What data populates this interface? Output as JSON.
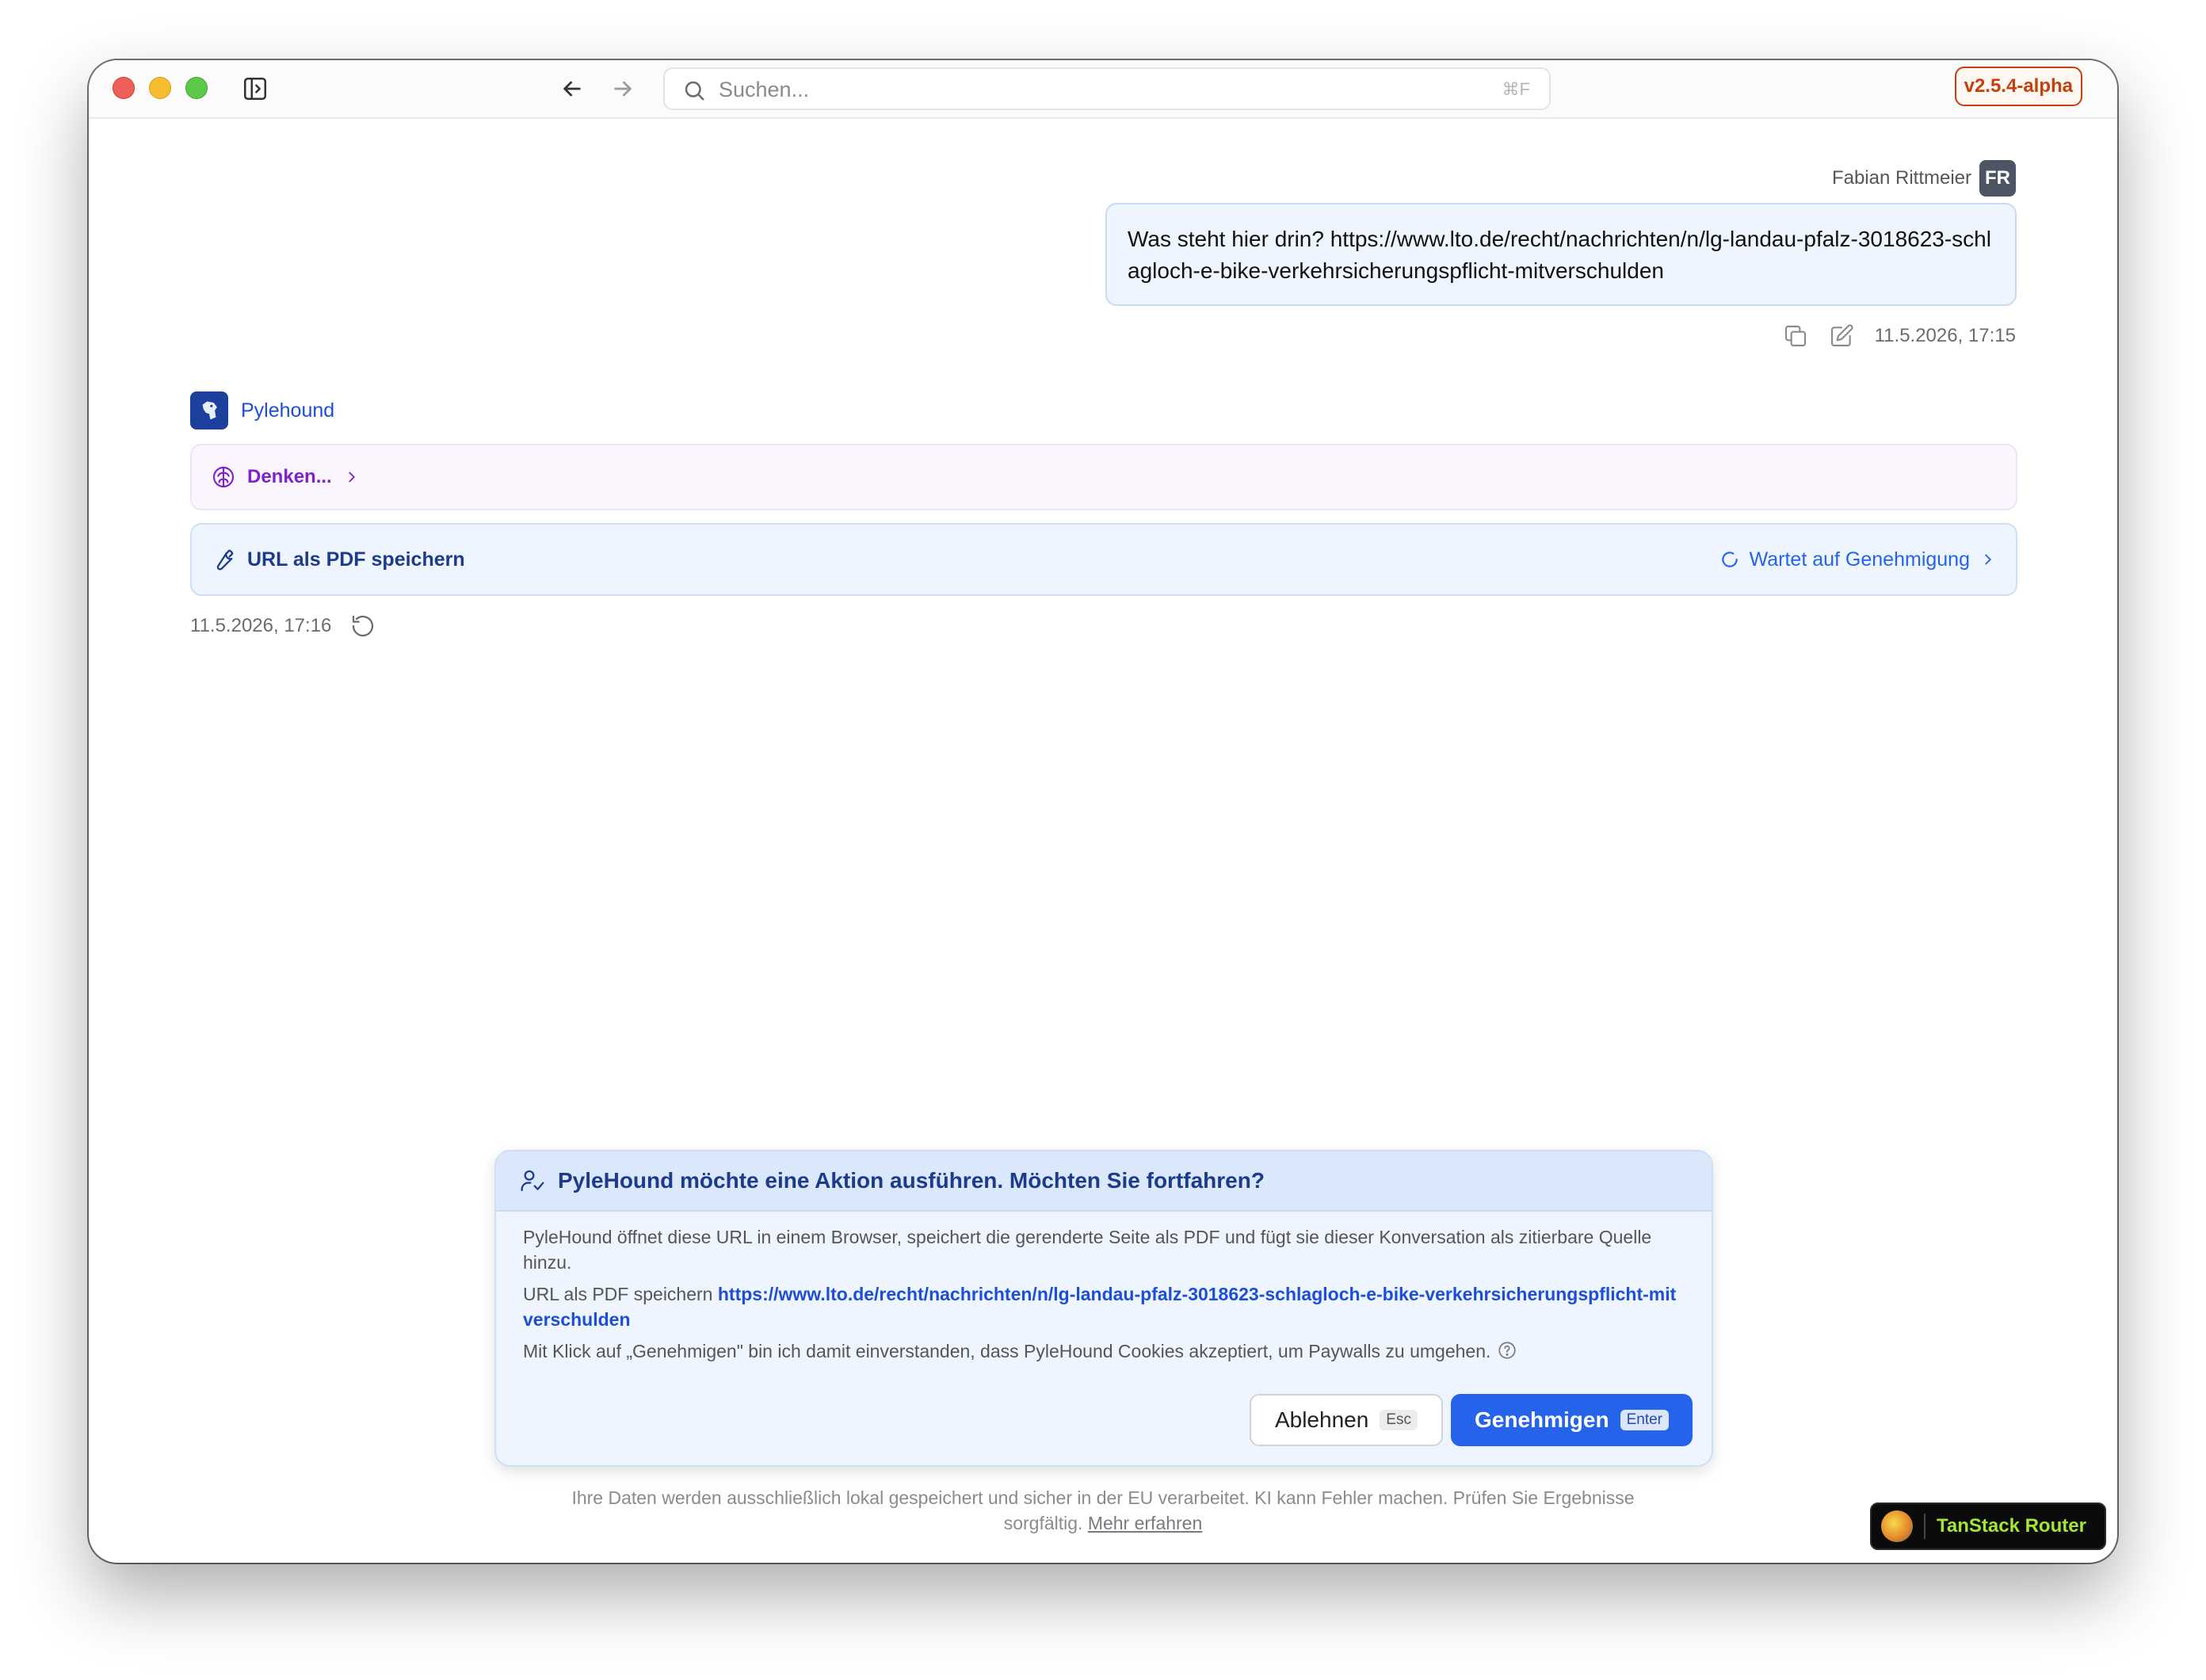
{
  "titlebar": {
    "search_placeholder": "Suchen...",
    "search_shortcut": "⌘F",
    "version": "v2.5.4-alpha"
  },
  "user_message": {
    "author": "Fabian Rittmeier",
    "initials": "FR",
    "text": "Was steht hier drin? https://www.lto.de/recht/nachrichten/n/lg-landau-pfalz-3018623-schlagloch-e-bike-verkehrsicherungspflicht-mitverschulden",
    "timestamp": "11.5.2026, 17:15"
  },
  "assistant": {
    "name": "Pylehound",
    "thinking_label": "Denken...",
    "tool_label": "URL als PDF speichern",
    "tool_status": "Wartet auf Genehmigung",
    "timestamp": "11.5.2026, 17:16"
  },
  "approval_dialog": {
    "title": "PyleHound möchte eine Aktion ausführen. Möchten Sie fortfahren?",
    "description": "PyleHound öffnet diese URL in einem Browser, speichert die gerenderte Seite als PDF und fügt sie dieser Konversation als zitierbare Quelle hinzu.",
    "action_prefix": "URL als PDF speichern",
    "action_url": "https://www.lto.de/recht/nachrichten/n/lg-landau-pfalz-3018623-schlagloch-e-bike-verkehrsicherungspflicht-mitverschulden",
    "consent": "Mit Klick auf „Genehmigen\" bin ich damit einverstanden, dass PyleHound Cookies akzeptiert, um Paywalls zu umgehen.",
    "reject_label": "Ablehnen",
    "reject_key": "Esc",
    "approve_label": "Genehmigen",
    "approve_key": "Enter"
  },
  "footer": {
    "text": "Ihre Daten werden ausschließlich lokal gespeichert und sicher in der EU verarbeitet. KI kann Fehler machen. Prüfen Sie Ergebnisse sorgfältig.",
    "link": "Mehr erfahren"
  },
  "devtools": {
    "label": "TanStack Router"
  },
  "colors": {
    "accent": "#2563eb",
    "thinking": "#7e22ce",
    "version_badge": "#c2410c",
    "tanstack_green": "#a3e635"
  },
  "icons": [
    "sidebar-toggle-icon",
    "arrow-left-icon",
    "arrow-right-icon",
    "search-icon",
    "copy-icon",
    "edit-icon",
    "bot-logo-icon",
    "brain-icon",
    "chevron-right-icon",
    "wrench-icon",
    "spinner-icon",
    "retry-icon",
    "user-check-icon",
    "help-circle-icon",
    "tanstack-logo-icon"
  ]
}
